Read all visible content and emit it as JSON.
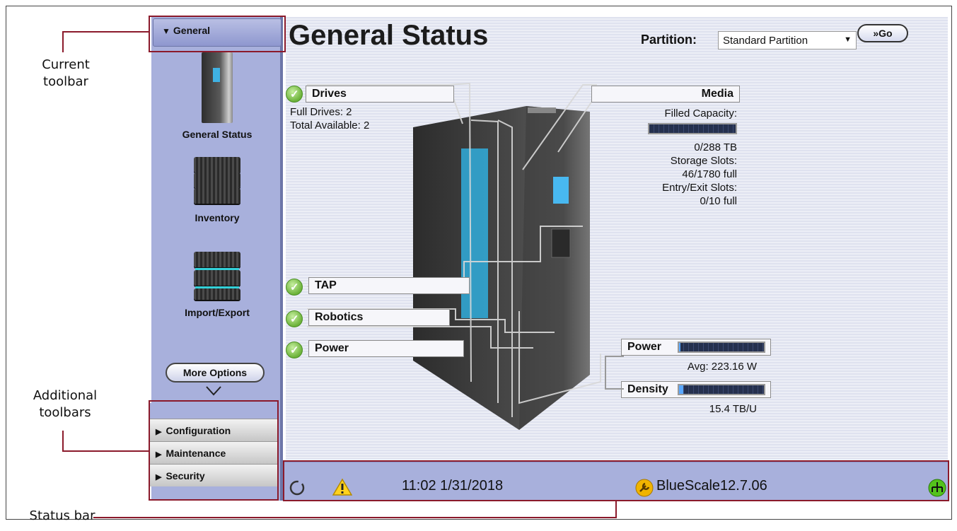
{
  "annotations": {
    "current_toolbar": "Current\ntoolbar",
    "additional_toolbars": "Additional\ntoolbars",
    "status_bar": "Status bar"
  },
  "sidebar": {
    "current_toolbar": "General",
    "items": [
      {
        "label": "General Status",
        "icon": "library-tower-icon"
      },
      {
        "label": "Inventory",
        "icon": "tape-stack-icon"
      },
      {
        "label": "Import/Export",
        "icon": "import-export-icon"
      }
    ],
    "more_options": "More Options",
    "toolbars": [
      "Configuration",
      "Maintenance",
      "Security"
    ]
  },
  "header": {
    "title": "General Status",
    "partition_label": "Partition:",
    "partition_value": "Standard Partition",
    "go_label": "Go"
  },
  "status_groups": {
    "drives": {
      "label": "Drives",
      "full": "Full Drives: 2",
      "total": "Total Available: 2"
    },
    "media": {
      "label": "Media",
      "filled_capacity": "Filled Capacity:",
      "capacity_value": "0/288 TB",
      "storage_slots": "Storage Slots:",
      "storage_value": "46/1780 full",
      "entry_exit": "Entry/Exit Slots:",
      "entry_value": "0/10 full"
    },
    "tap": "TAP",
    "robotics": "Robotics",
    "power": "Power"
  },
  "power_panel": {
    "power_label": "Power",
    "avg": "Avg: 223.16 W",
    "density_label": "Density",
    "density_value": "15.4 TB/U",
    "power_fraction": 0.02,
    "density_fraction": 0.05
  },
  "status_bar": {
    "time": "11:02 1/31/2018",
    "version": "BlueScale12.7.06"
  },
  "colors": {
    "annotation_red": "#8b1a2b",
    "sidebar": "#a8b0dc",
    "status_ok": "#6cb23a"
  }
}
